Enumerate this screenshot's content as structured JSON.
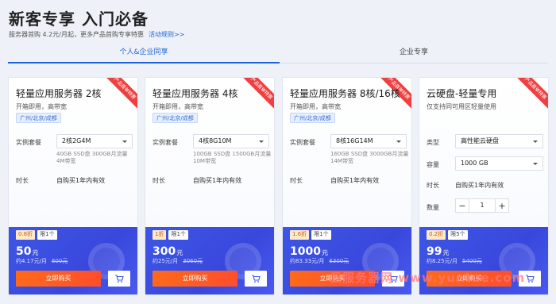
{
  "header": {
    "title": "新客专享 入门必备",
    "subtitle": "服务器首购 4.2元/月起，更多产品首购专享特惠",
    "rules_link": "活动规则>>"
  },
  "tabs": [
    {
      "label": "个人&企业同享",
      "active": true
    },
    {
      "label": "企业专享",
      "active": false
    }
  ],
  "labels": {
    "package": "实例套餐",
    "duration": "时长",
    "duration_value": "自购买1年内有效",
    "type": "类型",
    "capacity": "容量",
    "quantity": "数量",
    "buy": "立即购买",
    "ribbon": "产品首单特惠"
  },
  "cards": [
    {
      "title": "轻量应用服务器 2核",
      "desc": "开箱即用，高带宽",
      "region": "广州/北京/成都",
      "package": "2核2G4M",
      "spec": "40GB SSD盘 300GB月流量 4M带宽",
      "discount": "0.8折",
      "limit": "限1个",
      "price": "50",
      "unit": "元",
      "monthly": "约4.17元/月",
      "original": "600元"
    },
    {
      "title": "轻量应用服务器 4核",
      "desc": "开箱即用，高带宽",
      "region": "广州/北京/成都",
      "package": "4核8G10M",
      "spec": "100GB SSD盘 1500GB月流量 10M带宽",
      "discount": "1折",
      "limit": "限1个",
      "price": "300",
      "unit": "元",
      "monthly": "约25元/月",
      "original": "3060元"
    },
    {
      "title": "轻量应用服务器 8核/16核",
      "desc": "开箱即用，高带宽",
      "region": "广州/北京/成都",
      "package": "8核16G14M",
      "spec": "160GB SSD盘 3000GB月流量 14M带宽",
      "discount": "1.6折",
      "limit": "限1个",
      "price": "1000",
      "unit": "元",
      "monthly": "约83.33元/月",
      "original": "6300元"
    },
    {
      "title": "云硬盘-轻量专用",
      "desc": "仅支持同可用区轻量使用",
      "type_value": "高性能云硬盘",
      "capacity_value": "1000 GB",
      "quantity_value": "1",
      "discount": "0.2折",
      "limit": "限5个",
      "price": "99",
      "unit": "元",
      "monthly": "约8.25元/月",
      "original": "5400元"
    }
  ],
  "watermark": "云服务器网 www.yuntue.com",
  "colors": {
    "accent": "#1e63d9",
    "price_panel": "#3d56e6",
    "buy_button": "#ff5a22",
    "ribbon": "#ef4041"
  }
}
